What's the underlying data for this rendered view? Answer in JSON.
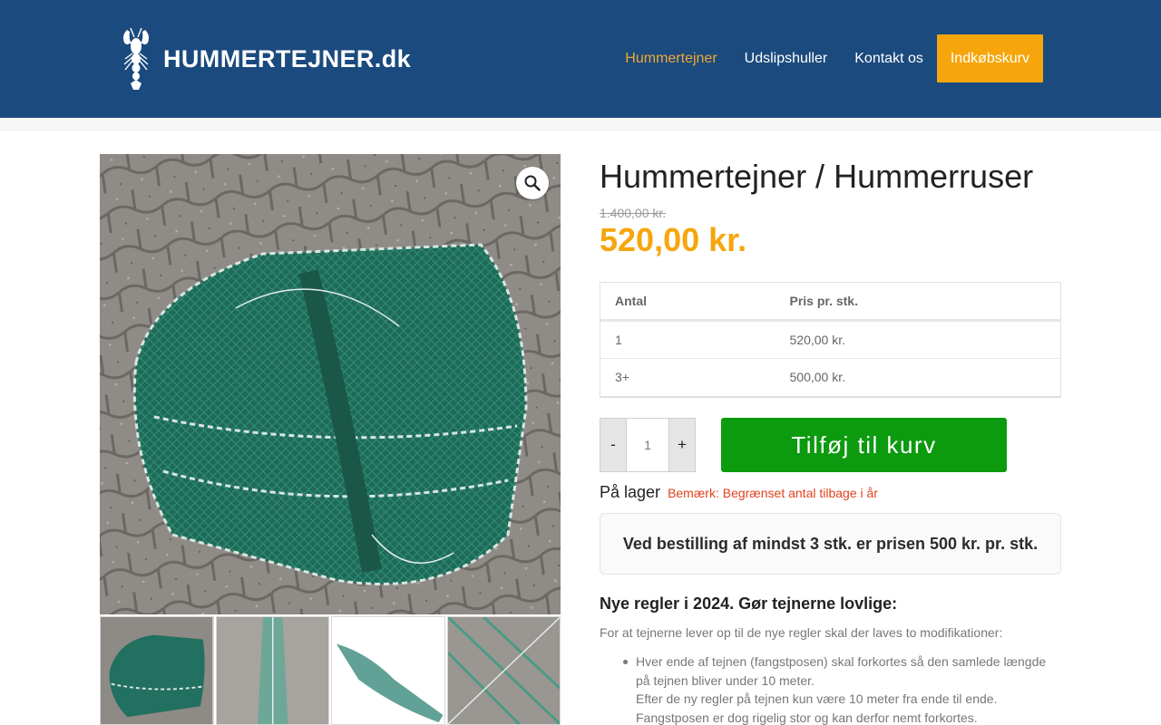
{
  "header": {
    "logo_text": "HUMMERTEJNER.dk",
    "nav": [
      {
        "label": "Hummertejner",
        "active": true
      },
      {
        "label": "Udslipshuller"
      },
      {
        "label": "Kontakt os"
      },
      {
        "label": "Indkøbskurv",
        "highlight": true
      }
    ]
  },
  "gallery": {
    "zoom_icon": "magnifier-icon",
    "thumbnail_count": 4
  },
  "product": {
    "title": "Hummertejner / Hummerruser",
    "old_price": "1.400,00 kr.",
    "price": "520,00 kr.",
    "tier_table": {
      "headers": [
        "Antal",
        "Pris pr. stk."
      ],
      "rows": [
        [
          "1",
          "520,00 kr."
        ],
        [
          "3+",
          "500,00 kr."
        ]
      ]
    },
    "quantity": {
      "minus": "-",
      "value": "1",
      "plus": "+"
    },
    "add_to_cart": "Tilføj til kurv",
    "stock": "På lager",
    "stock_note": "Bemærk: Begrænset antal tilbage i år",
    "notice": "Ved bestilling af mindst 3 stk. er prisen 500 kr. pr. stk.",
    "rules_heading": "Nye regler i 2024. Gør tejnerne lovlige:",
    "rules_intro": "For at tejnerne lever op til de nye regler skal der laves to modifikationer:",
    "rules_item_1": "Hver ende af tejnen (fangstposen) skal forkortes så den samlede længde på tejnen bliver under 10 meter.",
    "rules_item_1b": "Efter de ny regler på tejnen kun være 10 meter fra ende til ende.",
    "rules_item_1c": "Fangstposen er dog rigelig stor og kan derfor nemt forkortes."
  },
  "colors": {
    "header_bg": "#1b4a7e",
    "nav_active": "#f0a835",
    "cart_bg": "#f6a60c",
    "price": "#f6a60c",
    "add_button": "#0c9a0e",
    "stock_note": "#e2401c"
  }
}
